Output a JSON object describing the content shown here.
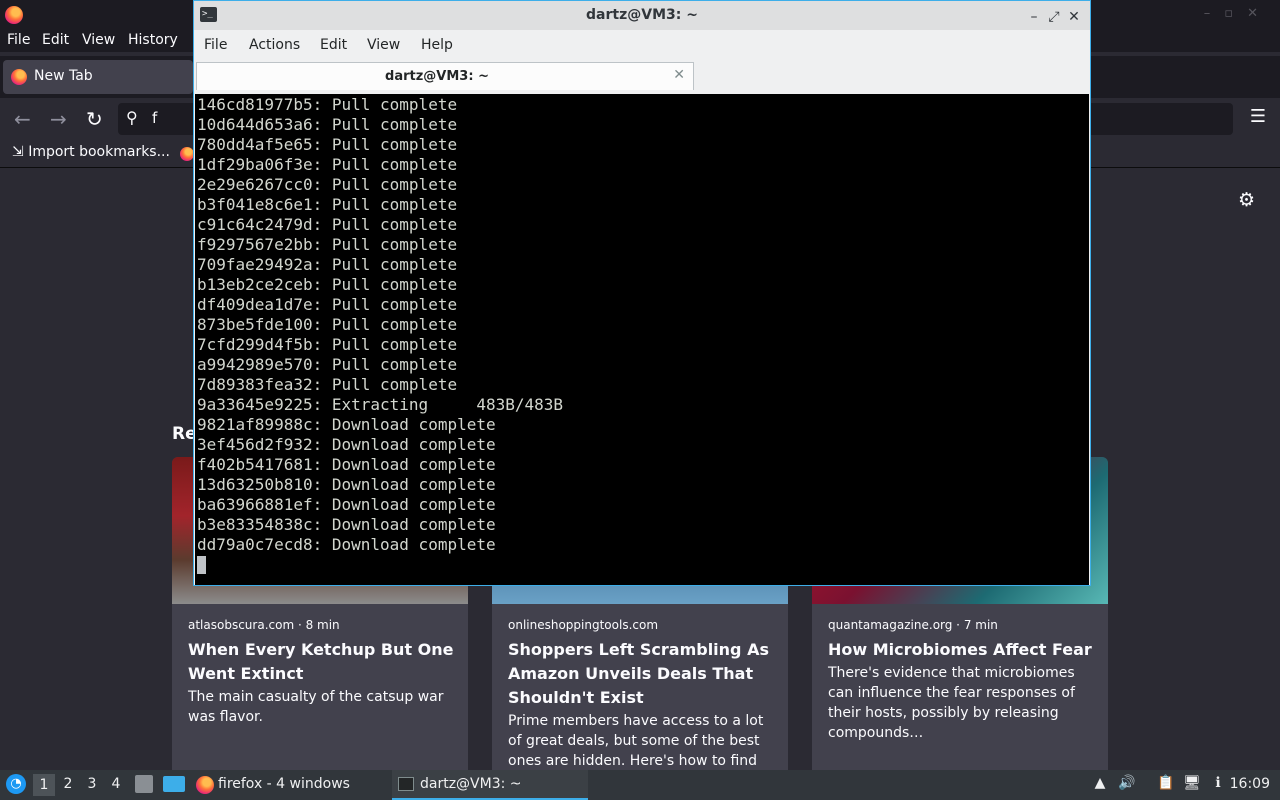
{
  "firefox": {
    "menu": [
      "File",
      "Edit",
      "View",
      "History"
    ],
    "tab_title": "New Tab",
    "url_text": "f",
    "bookmark_label": "Import bookmarks...",
    "recommended_heading": "Re",
    "cards": [
      {
        "source": "atlasobscura.com · 8 min",
        "title": "When Every Ketchup But One Went Extinct",
        "excerpt": "The main casualty of the catsup war was flavor."
      },
      {
        "source": "onlineshoppingtools.com",
        "title": "Shoppers Left Scrambling As Amazon Unveils Deals That Shouldn't Exist",
        "excerpt": "Prime members have access to a lot of great deals, but some of the best ones are hidden. Here's how to find them."
      },
      {
        "source": "quantamagazine.org · 7 min",
        "title": "How Microbiomes Affect Fear",
        "excerpt": "There's evidence that microbiomes can influence the fear responses of their hosts, possibly by releasing compounds…"
      }
    ]
  },
  "terminal": {
    "window_title": "dartz@VM3: ~",
    "menu": [
      "File",
      "Actions",
      "Edit",
      "View",
      "Help"
    ],
    "tab_title": "dartz@VM3: ~",
    "lines": [
      "146cd81977b5: Pull complete",
      "10d644d653a6: Pull complete",
      "780dd4af5e65: Pull complete",
      "1df29ba06f3e: Pull complete",
      "2e29e6267cc0: Pull complete",
      "b3f041e8c6e1: Pull complete",
      "c91c64c2479d: Pull complete",
      "f9297567e2bb: Pull complete",
      "709fae29492a: Pull complete",
      "b13eb2ce2ceb: Pull complete",
      "df409dea1d7e: Pull complete",
      "873be5fde100: Pull complete",
      "7cfd299d4f5b: Pull complete",
      "a9942989e570: Pull complete",
      "7d89383fea32: Pull complete",
      "9a33645e9225: Extracting     483B/483B",
      "9821af89988c: Download complete",
      "3ef456d2f932: Download complete",
      "f402b5417681: Download complete",
      "13d63250b810: Download complete",
      "ba63966881ef: Download complete",
      "b3e83354838c: Download complete",
      "dd79a0c7ecd8: Download complete"
    ]
  },
  "taskbar": {
    "workspaces": [
      "1",
      "2",
      "3",
      "4"
    ],
    "active_workspace": "1",
    "tasks": [
      {
        "label": "firefox - 4 windows",
        "icon": "firefox-icon"
      },
      {
        "label": "dartz@VM3: ~",
        "icon": "terminal-icon"
      }
    ],
    "clock": "16:09"
  },
  "colors": {
    "accent": "#3daee9",
    "firefox_bg": "#2b2a33",
    "terminal_bg": "#000000",
    "taskbar_bg": "#31363b"
  }
}
